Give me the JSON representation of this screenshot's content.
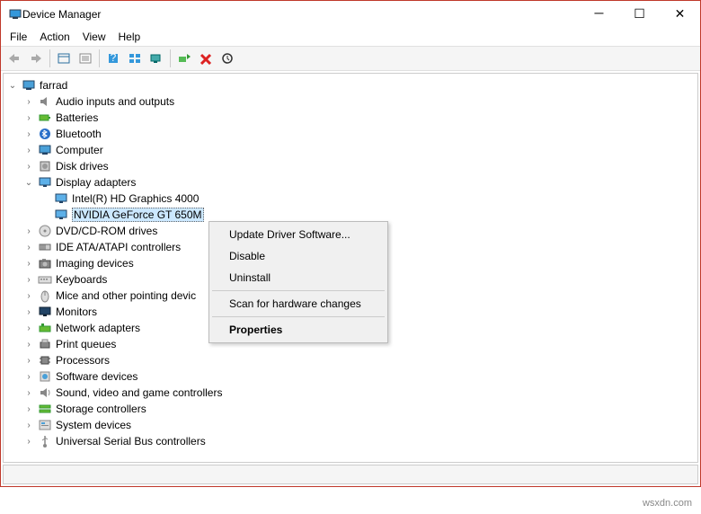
{
  "window": {
    "title": "Device Manager"
  },
  "menus": {
    "file": "File",
    "action": "Action",
    "view": "View",
    "help": "Help"
  },
  "root": "farrad",
  "tree": [
    {
      "label": "Audio inputs and outputs",
      "icon": "audio",
      "expanded": false
    },
    {
      "label": "Batteries",
      "icon": "battery",
      "expanded": false
    },
    {
      "label": "Bluetooth",
      "icon": "bluetooth",
      "expanded": false
    },
    {
      "label": "Computer",
      "icon": "computer",
      "expanded": false
    },
    {
      "label": "Disk drives",
      "icon": "disk",
      "expanded": false
    },
    {
      "label": "Display adapters",
      "icon": "display",
      "expanded": true,
      "children": [
        {
          "label": "Intel(R) HD Graphics 4000",
          "icon": "display"
        },
        {
          "label": "NVIDIA GeForce GT 650M",
          "icon": "display",
          "selected": true
        }
      ]
    },
    {
      "label": "DVD/CD-ROM drives",
      "icon": "dvd",
      "expanded": false
    },
    {
      "label": "IDE ATA/ATAPI controllers",
      "icon": "ide",
      "expanded": false
    },
    {
      "label": "Imaging devices",
      "icon": "camera",
      "expanded": false
    },
    {
      "label": "Keyboards",
      "icon": "keyboard",
      "expanded": false
    },
    {
      "label": "Mice and other pointing devic",
      "icon": "mouse",
      "expanded": false
    },
    {
      "label": "Monitors",
      "icon": "monitor",
      "expanded": false
    },
    {
      "label": "Network adapters",
      "icon": "network",
      "expanded": false
    },
    {
      "label": "Print queues",
      "icon": "printer",
      "expanded": false
    },
    {
      "label": "Processors",
      "icon": "cpu",
      "expanded": false
    },
    {
      "label": "Software devices",
      "icon": "software",
      "expanded": false
    },
    {
      "label": "Sound, video and game controllers",
      "icon": "sound",
      "expanded": false
    },
    {
      "label": "Storage controllers",
      "icon": "storage",
      "expanded": false
    },
    {
      "label": "System devices",
      "icon": "system",
      "expanded": false
    },
    {
      "label": "Universal Serial Bus controllers",
      "icon": "usb",
      "expanded": false
    }
  ],
  "context": {
    "update": "Update Driver Software...",
    "disable": "Disable",
    "uninstall": "Uninstall",
    "scan": "Scan for hardware changes",
    "properties": "Properties"
  },
  "watermark": "wsxdn.com"
}
